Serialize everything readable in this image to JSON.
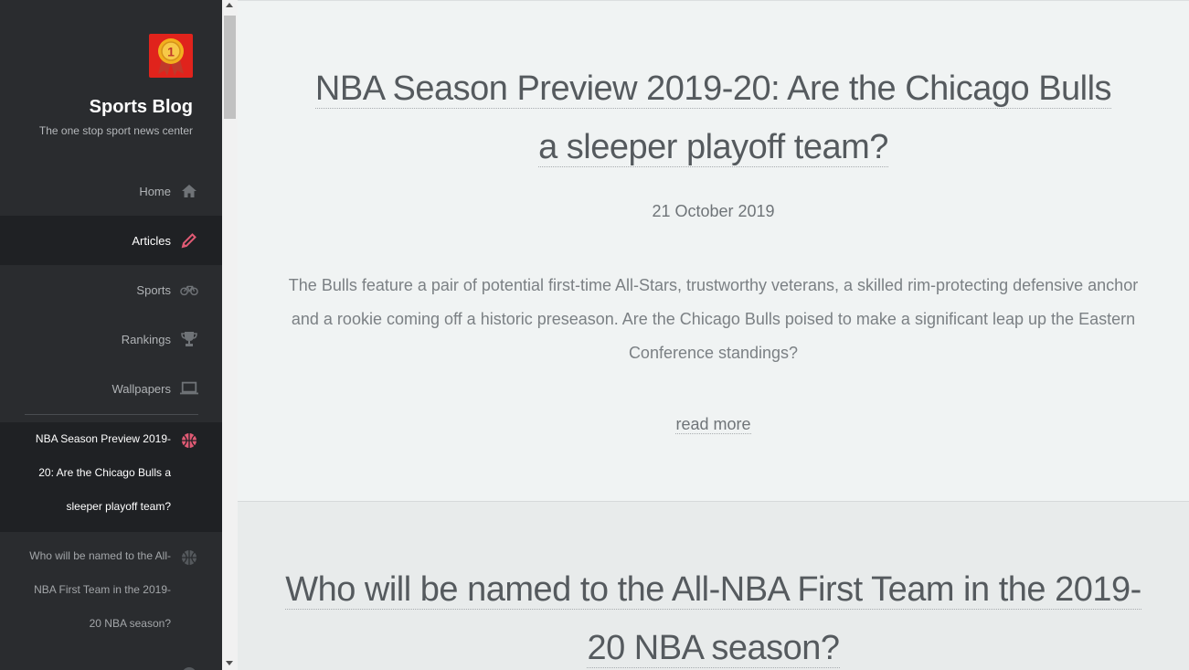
{
  "site": {
    "title": "Sports Blog",
    "tagline": "The one stop sport news center",
    "logo_number": "1"
  },
  "nav": {
    "items": [
      {
        "label": "Home",
        "icon": "home-icon"
      },
      {
        "label": "Articles",
        "icon": "pencil-icon",
        "active": true
      },
      {
        "label": "Sports",
        "icon": "bicycle-icon"
      },
      {
        "label": "Rankings",
        "icon": "trophy-icon"
      },
      {
        "label": "Wallpapers",
        "icon": "laptop-icon"
      }
    ],
    "posts": [
      {
        "label": "NBA Season Preview 2019-20: Are the Chicago Bulls a sleeper playoff team?",
        "icon": "basketball-icon",
        "active": true
      },
      {
        "label": "Who will be named to the All-NBA First Team in the 2019-20 NBA season?",
        "icon": "basketball-icon"
      }
    ]
  },
  "articles": [
    {
      "title": "NBA Season Preview 2019-20: Are the Chicago Bulls a sleeper playoff team?",
      "date": "21 October 2019",
      "excerpt": "The Bulls feature a pair of potential first-time All-Stars, trustworthy veterans, a skilled rim-protecting defensive anchor and a rookie coming off a historic preseason. Are the Chicago Bulls poised to make a significant leap up the Eastern Conference standings?",
      "read_more": "read more"
    },
    {
      "title": "Who will be named to the All-NBA First Team in the 2019-20 NBA season?"
    }
  ],
  "colors": {
    "accent": "#e05a74",
    "sidebar_bg": "#2a2c2f",
    "logo_bg": "#e0231c",
    "medal_gold": "#f2b01e"
  }
}
